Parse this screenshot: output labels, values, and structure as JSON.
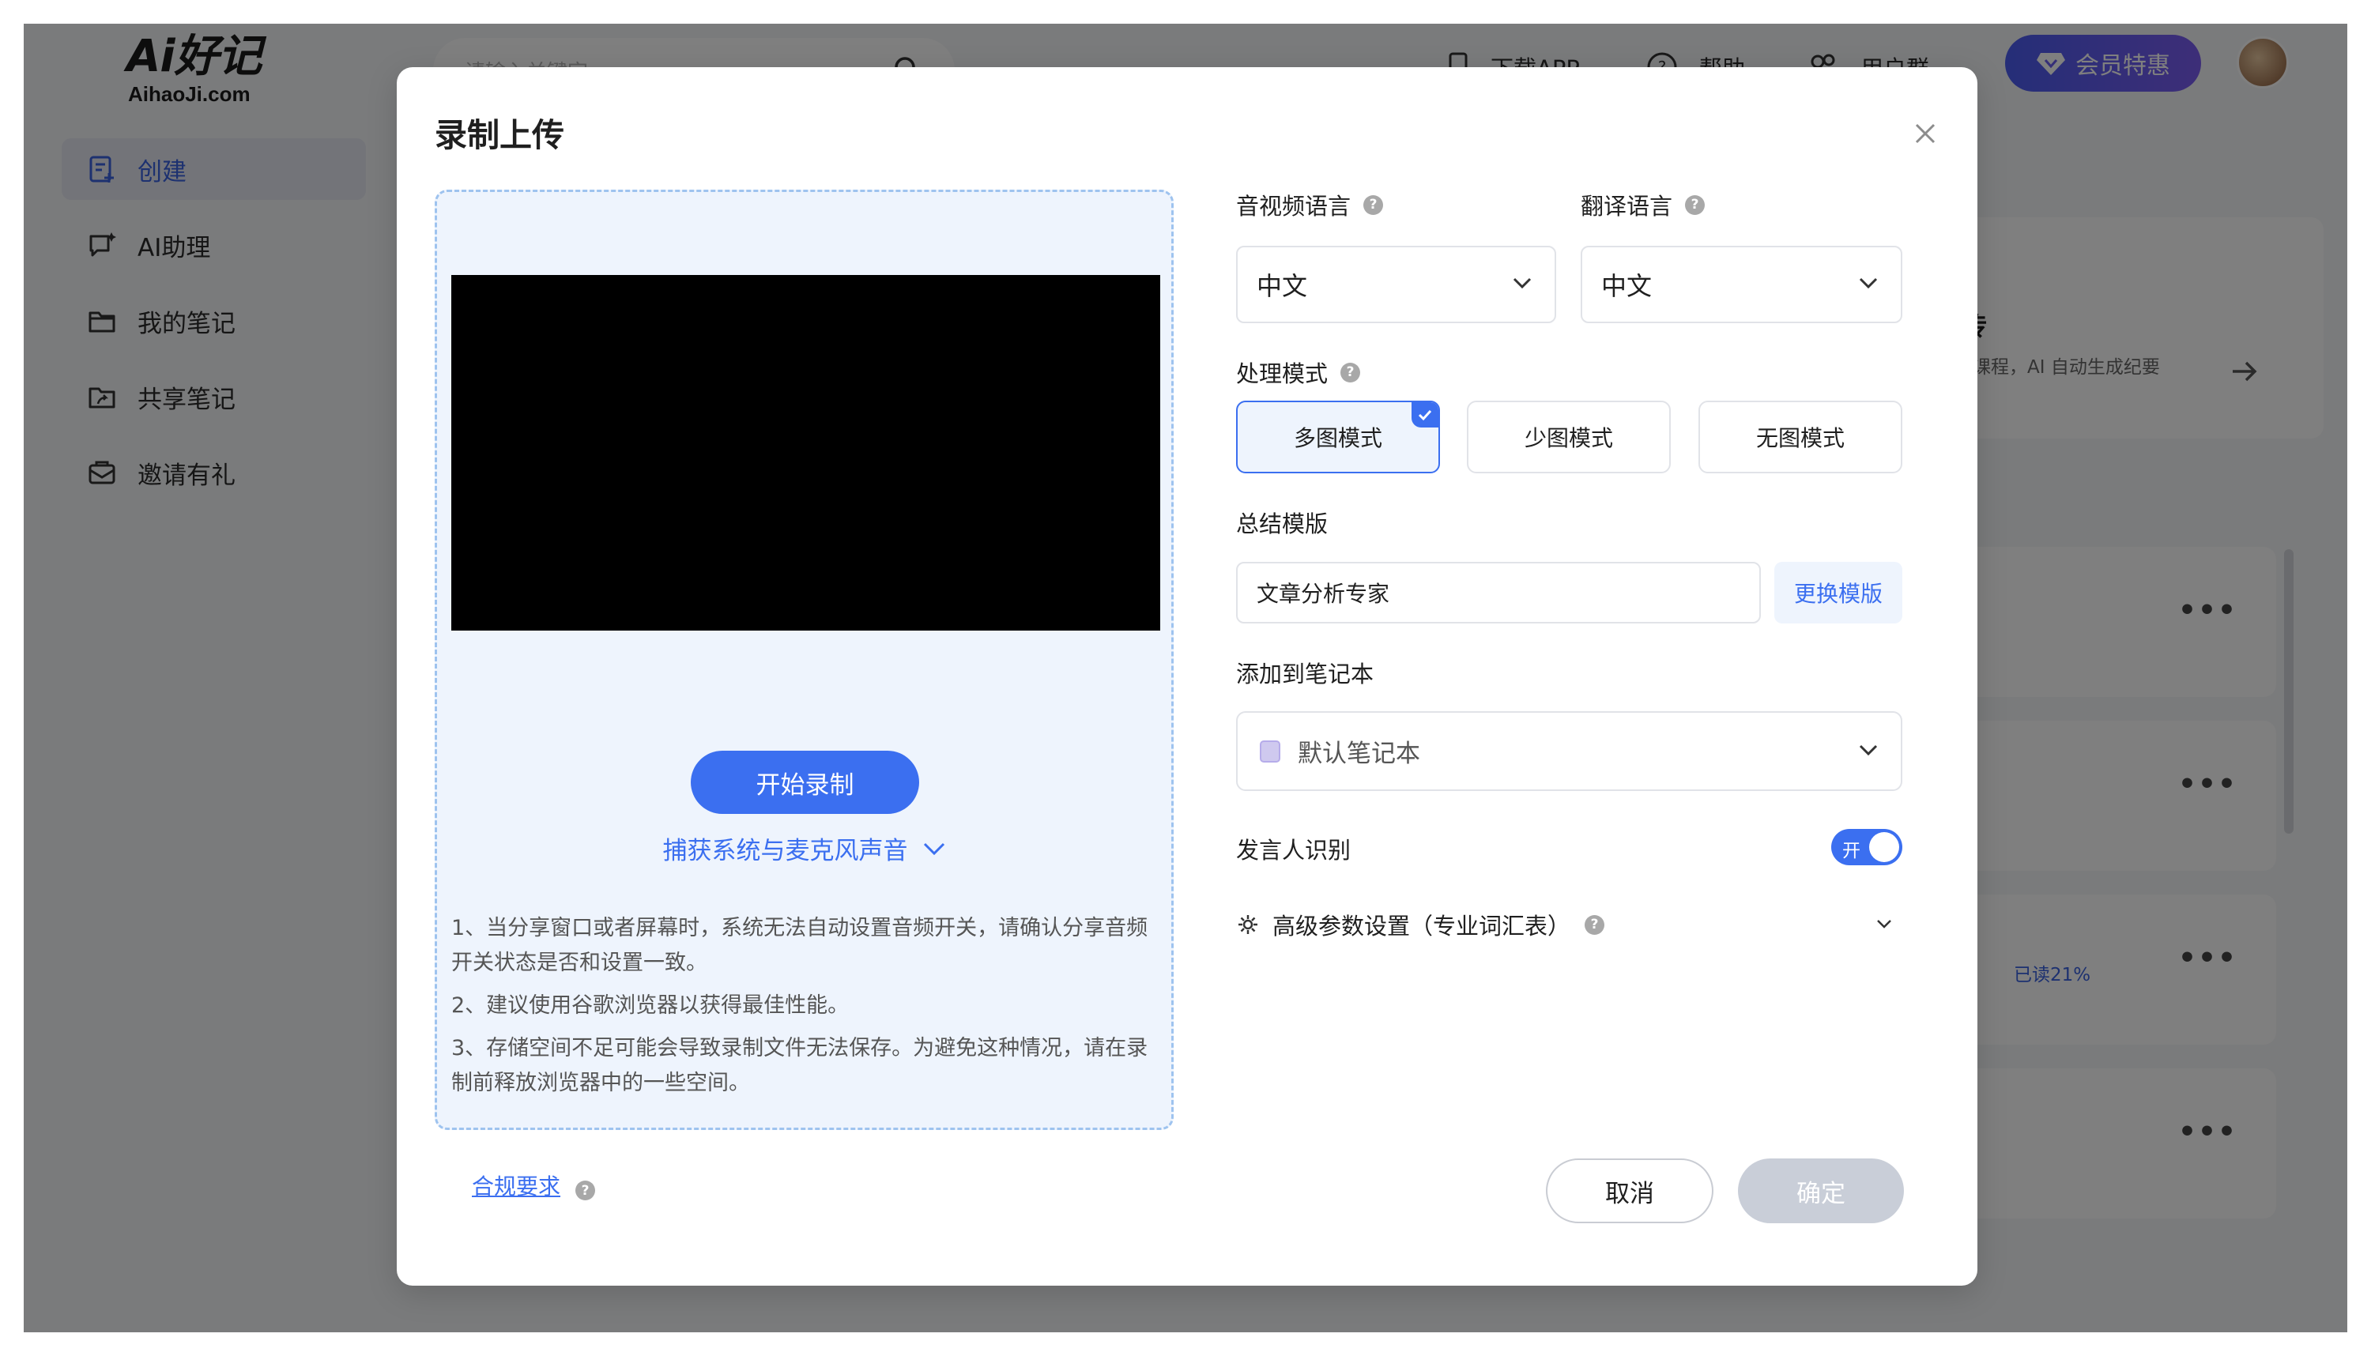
{
  "app": {
    "logo": {
      "main": "Ai好记",
      "sub": "AihaoJi.com"
    },
    "sidebar": {
      "items": [
        {
          "label": "创建",
          "icon": "create-note-icon",
          "active": true
        },
        {
          "label": "AI助理",
          "icon": "ai-chat-icon",
          "active": false
        },
        {
          "label": "我的笔记",
          "icon": "folder-icon",
          "active": false
        },
        {
          "label": "共享笔记",
          "icon": "shared-folder-icon",
          "active": false
        },
        {
          "label": "邀请有礼",
          "icon": "gift-mail-icon",
          "active": false
        }
      ]
    },
    "search": {
      "placeholder": "请输入关键字"
    },
    "topnav": {
      "download": "下载APP",
      "help": "帮助",
      "user_group": "用户群",
      "vip": "会员特惠"
    },
    "background": {
      "upload_card_title": "上传",
      "upload_card_desc": "议或课程，AI 自动生成纪要",
      "read_progress": "已读21%",
      "more": "•••"
    }
  },
  "modal": {
    "title": "录制上传",
    "record": {
      "start_button": "开始录制",
      "audio_source": "捕获系统与麦克风声音",
      "notes": [
        "1、当分享窗口或者屏幕时，系统无法自动设置音频开关，请确认分享音频开关状态是否和设置一致。",
        "2、建议使用谷歌浏览器以获得最佳性能。",
        "3、存储空间不足可能会导致录制文件无法保存。为避免这种情况，请在录制前释放浏览器中的一些空间。"
      ]
    },
    "compliance_link": "合规要求",
    "form": {
      "audio_language_label": "音视频语言",
      "audio_language_value": "中文",
      "translate_language_label": "翻译语言",
      "translate_language_value": "中文",
      "mode_label": "处理模式",
      "modes": [
        {
          "label": "多图模式",
          "selected": true
        },
        {
          "label": "少图模式",
          "selected": false
        },
        {
          "label": "无图模式",
          "selected": false
        }
      ],
      "template_label": "总结模版",
      "template_value": "文章分析专家",
      "template_change": "更换模版",
      "notebook_label": "添加到笔记本",
      "notebook_value": "默认笔记本",
      "speaker_label": "发言人识别",
      "speaker_toggle": "开",
      "speaker_on": true,
      "advanced_label": "高级参数设置（专业词汇表）"
    },
    "footer": {
      "cancel": "取消",
      "confirm": "确定"
    },
    "help_glyph": "?"
  },
  "colors": {
    "accent": "#3b6ff0",
    "overlay": "rgba(0,0,0,0.5)",
    "disabled": "#c9ced8",
    "panel_bg": "#eef4fd"
  }
}
